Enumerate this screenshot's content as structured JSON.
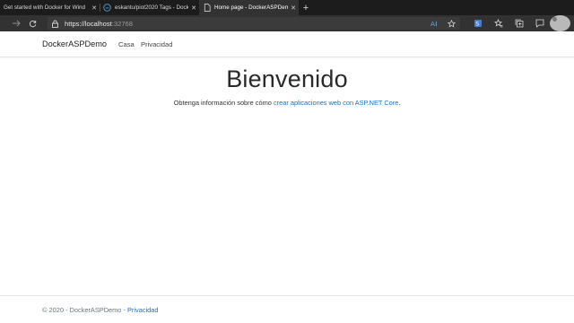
{
  "browser": {
    "tabs": [
      {
        "title": "Get started with Docker for Wind",
        "favicon": "none",
        "active": false
      },
      {
        "title": "eskantu/piot2020 Tags - Docker H",
        "favicon": "docker-icon",
        "active": false
      },
      {
        "title": "Home page - DockerASPDemo",
        "favicon": "page-icon",
        "active": true
      }
    ],
    "new_tab_label": "+",
    "close_label": "✕",
    "url_host": "https://localhost",
    "url_port": ":32768"
  },
  "site": {
    "brand": "DockerASPDemo",
    "nav": {
      "home": "Casa",
      "privacy": "Privacidad"
    },
    "heading": "Bienvenido",
    "lead_prefix": "Obtenga información sobre cómo ",
    "lead_link": "crear aplicaciones web con ASP.NET Core",
    "lead_suffix": ".",
    "footer_prefix": "© 2020 - DockerASPDemo - ",
    "footer_link": "Privacidad"
  },
  "colors": {
    "link": "#1b6ec2",
    "tabstrip": "#1c1c1c",
    "toolbar": "#323232"
  }
}
